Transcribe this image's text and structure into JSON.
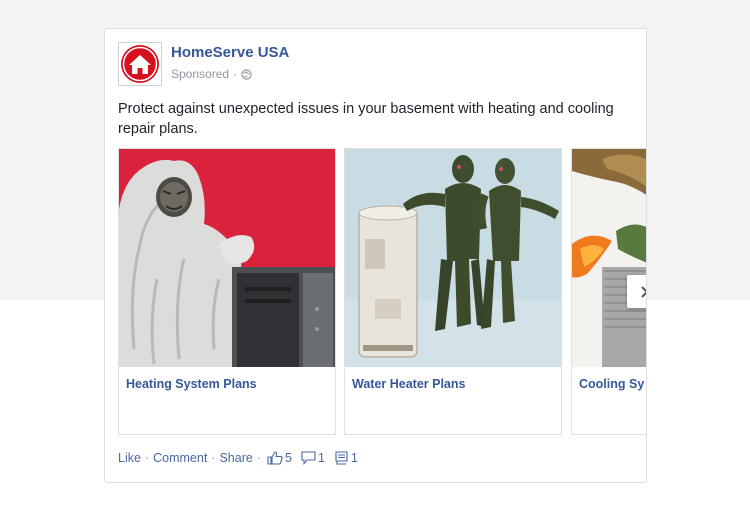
{
  "post": {
    "page_name": "HomeServe USA",
    "sponsored_label": "Sponsored",
    "meta_separator": "·",
    "text": "Protect against unexpected issues in your basement with heating and cooling repair plans.",
    "logo_icon": "house-icon",
    "globe_icon": "globe-icon"
  },
  "carousel": {
    "cards": [
      {
        "title": "Heating System Plans",
        "image": "yeti-with-furnace"
      },
      {
        "title": "Water Heater Plans",
        "image": "swamp-monsters-with-water-heater"
      },
      {
        "title": "Cooling Sy",
        "image": "dragon-with-air-conditioner"
      }
    ],
    "next_icon": "chevron-right-icon"
  },
  "actions": {
    "like": "Like",
    "comment": "Comment",
    "share": "Share",
    "separator": "·",
    "likes_count": "5",
    "comments_count": "1",
    "shares_count": "1"
  },
  "colors": {
    "link": "#365899",
    "brand_red": "#d6101f",
    "muted": "#90949c"
  }
}
